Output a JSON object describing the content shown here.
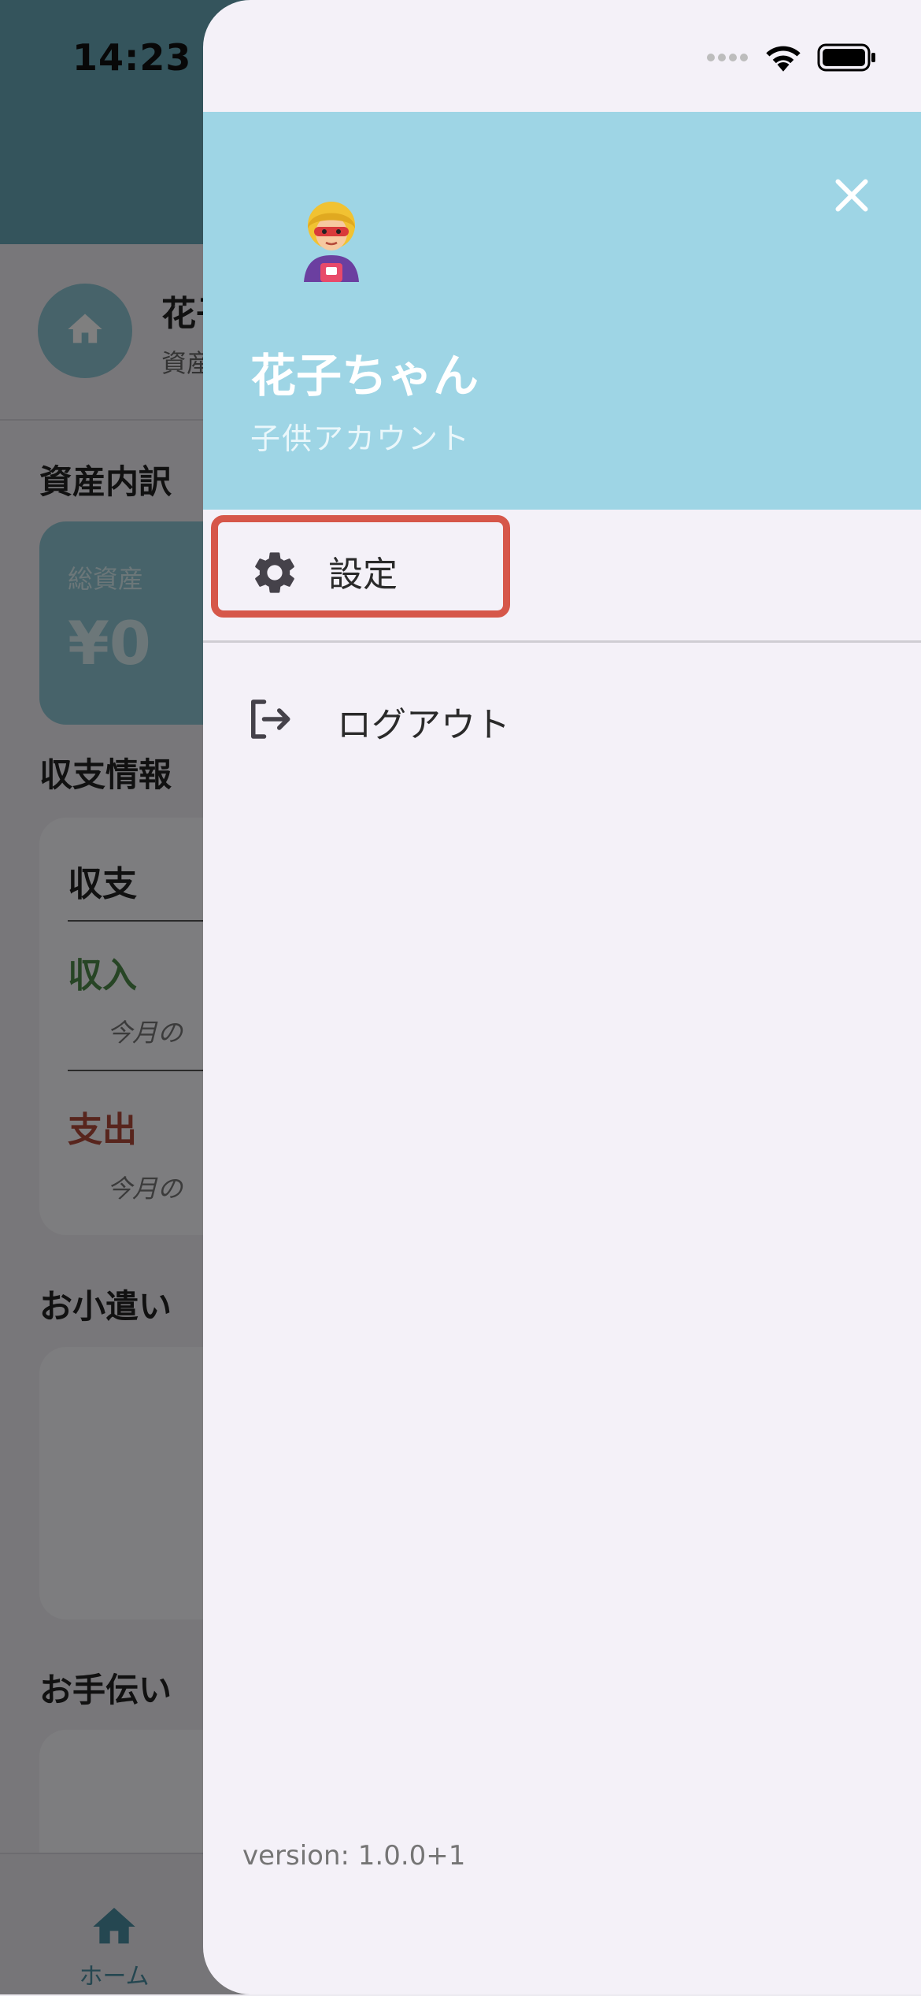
{
  "status_bar": {
    "time": "14:23"
  },
  "background": {
    "profile": {
      "name": "花子ちゃん",
      "subtitle": "資産"
    },
    "sections": {
      "assets_breakdown": "資産内訳",
      "income_info": "収支情報",
      "allowance": "お小遣い",
      "chores": "お手伝い"
    },
    "asset_card": {
      "label": "総資産",
      "value": "¥0"
    },
    "balance_card": {
      "title": "収支",
      "income": "収入",
      "income_sub": "今月の",
      "expense": "支出",
      "expense_sub": "今月の"
    },
    "bottom_nav": {
      "home": "ホーム"
    }
  },
  "drawer": {
    "user_name": "花子ちゃん",
    "user_role": "子供アカウント",
    "avatar": "superhero-avatar",
    "menu": [
      {
        "label": "設定",
        "icon": "gear-icon"
      },
      {
        "label": "ログアウト",
        "icon": "logout-icon"
      }
    ],
    "version": "version: 1.0.0+1"
  },
  "colors": {
    "header": "#9ed5e5",
    "highlight": "#d6574a",
    "drawer_bg": "#f4f1f8",
    "income": "#4e8a4a",
    "expense": "#b04a3a"
  }
}
